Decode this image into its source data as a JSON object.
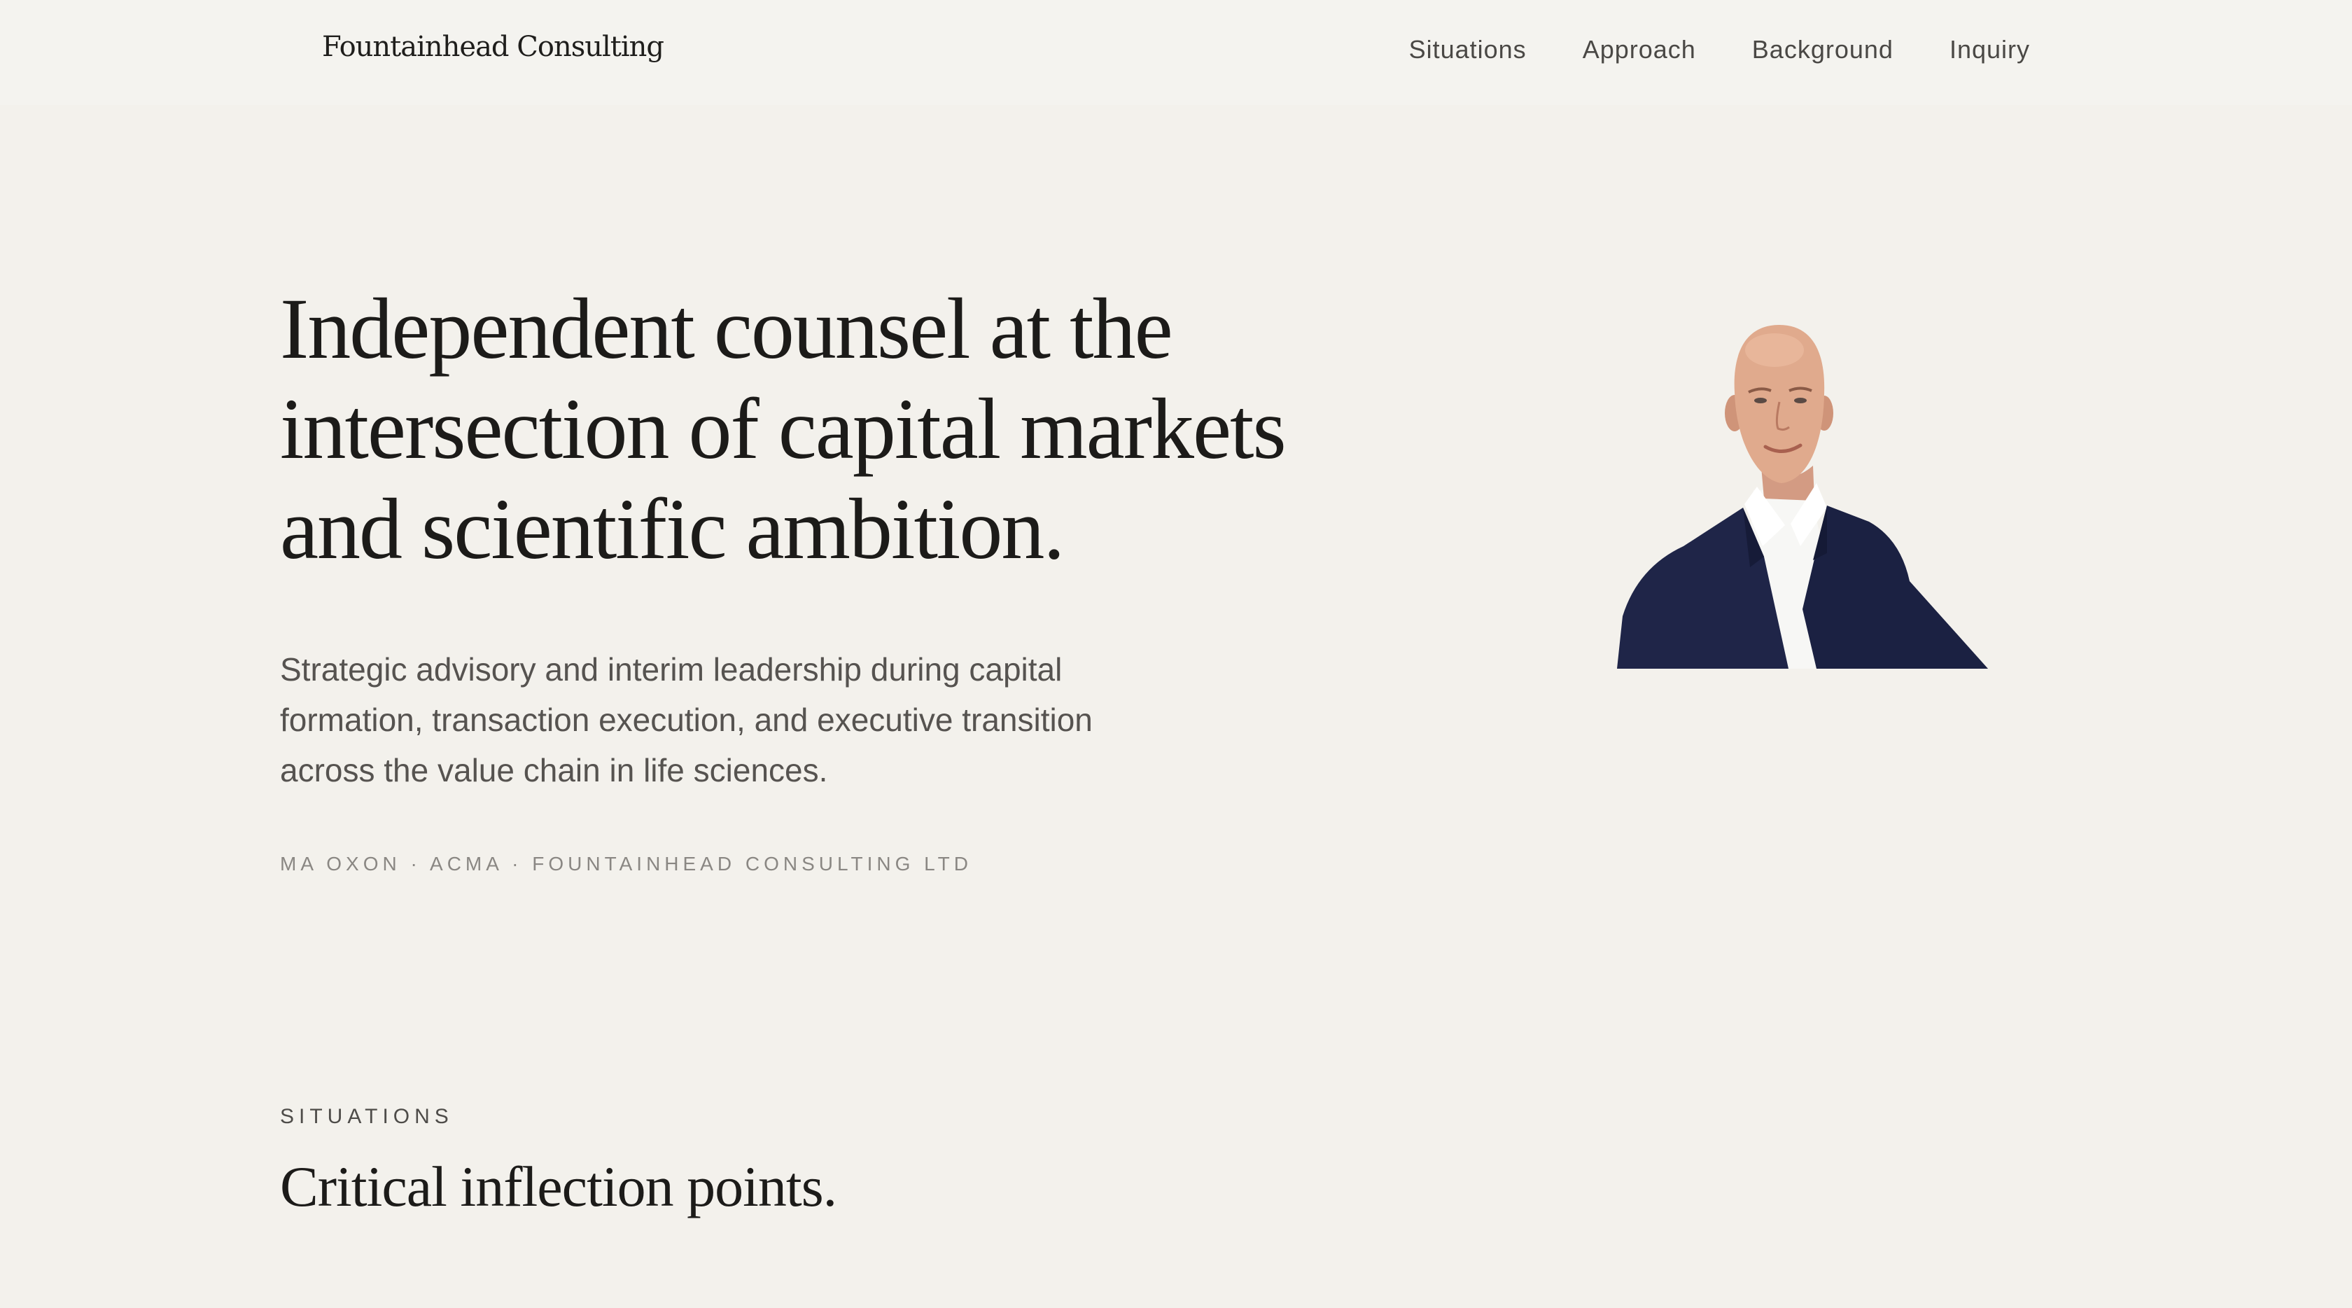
{
  "header": {
    "brand": "Fountainhead Consulting",
    "nav": [
      {
        "label": "Situations"
      },
      {
        "label": "Approach"
      },
      {
        "label": "Background"
      },
      {
        "label": "Inquiry"
      }
    ]
  },
  "hero": {
    "title": "Independent counsel at the intersection of capital markets and scientific ambition.",
    "subtitle": "Strategic advisory and interim leadership during capital formation, transaction execution, and executive transition across the value chain in life sciences.",
    "credentials": "MA OXON · ACMA · FOUNTAINHEAD CONSULTING LTD"
  },
  "situations": {
    "label": "SITUATIONS",
    "title": "Critical inflection points."
  },
  "colors": {
    "background": "#f3f1ec",
    "text": "#1c1b19",
    "muted": "#565350",
    "suit": "#1f2548"
  }
}
